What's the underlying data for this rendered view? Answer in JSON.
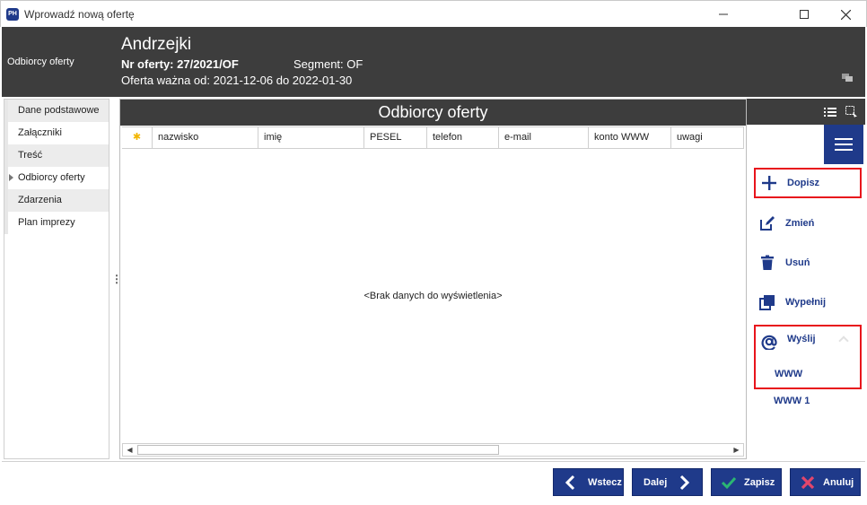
{
  "window": {
    "title": "Wprowadź nową ofertę",
    "app_icon_text": "PH"
  },
  "header": {
    "section": "Odbiorcy oferty",
    "client_name": "Andrzejki",
    "offer_number": "Nr oferty: 27/2021/OF",
    "segment": "Segment: OF",
    "valid": "Oferta ważna od: 2021-12-06 do 2022-01-30"
  },
  "nav": {
    "items": [
      {
        "label": "Dane podstawowe"
      },
      {
        "label": "Załączniki"
      },
      {
        "label": "Treść"
      },
      {
        "label": "Odbiorcy oferty"
      },
      {
        "label": "Zdarzenia"
      },
      {
        "label": "Plan imprezy"
      }
    ]
  },
  "grid": {
    "title": "Odbiorcy oferty",
    "columns": [
      "nazwisko",
      "imię",
      "PESEL",
      "telefon",
      "e-mail",
      "konto WWW",
      "uwagi"
    ],
    "star_glyph": "✱",
    "empty_message": "<Brak danych do wyświetlenia>"
  },
  "actions": {
    "dopisz": "Dopisz",
    "zmien": "Zmień",
    "usun": "Usuń",
    "wypelnij": "Wypełnij",
    "wyslij": "Wyślij",
    "sub_www": "WWW",
    "sub_www1": "WWW 1"
  },
  "buttons": {
    "back": "Wstecz",
    "next": "Dalej",
    "save": "Zapisz",
    "cancel": "Anuluj"
  },
  "colors": {
    "accent": "#1f3a8a",
    "header_bg": "#3d3d3d",
    "highlight": "#e8141c",
    "save_check": "#2bb673",
    "cancel_x": "#e3466b"
  }
}
